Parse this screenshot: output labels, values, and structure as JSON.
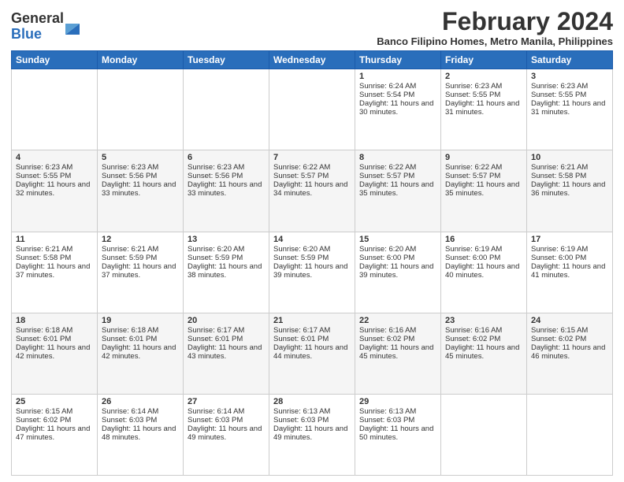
{
  "logo": {
    "line1": "General",
    "line2": "Blue",
    "icon_color": "#2a6ebb"
  },
  "header": {
    "month_year": "February 2024",
    "location": "Banco Filipino Homes, Metro Manila, Philippines"
  },
  "weekdays": [
    "Sunday",
    "Monday",
    "Tuesday",
    "Wednesday",
    "Thursday",
    "Friday",
    "Saturday"
  ],
  "weeks": [
    [
      {
        "day": "",
        "sun": "",
        "info": ""
      },
      {
        "day": "",
        "info": ""
      },
      {
        "day": "",
        "info": ""
      },
      {
        "day": "",
        "info": ""
      },
      {
        "day": "1",
        "info": "Sunrise: 6:24 AM\nSunset: 5:54 PM\nDaylight: 11 hours and 30 minutes."
      },
      {
        "day": "2",
        "info": "Sunrise: 6:23 AM\nSunset: 5:55 PM\nDaylight: 11 hours and 31 minutes."
      },
      {
        "day": "3",
        "info": "Sunrise: 6:23 AM\nSunset: 5:55 PM\nDaylight: 11 hours and 31 minutes."
      }
    ],
    [
      {
        "day": "4",
        "info": "Sunrise: 6:23 AM\nSunset: 5:55 PM\nDaylight: 11 hours and 32 minutes."
      },
      {
        "day": "5",
        "info": "Sunrise: 6:23 AM\nSunset: 5:56 PM\nDaylight: 11 hours and 33 minutes."
      },
      {
        "day": "6",
        "info": "Sunrise: 6:23 AM\nSunset: 5:56 PM\nDaylight: 11 hours and 33 minutes."
      },
      {
        "day": "7",
        "info": "Sunrise: 6:22 AM\nSunset: 5:57 PM\nDaylight: 11 hours and 34 minutes."
      },
      {
        "day": "8",
        "info": "Sunrise: 6:22 AM\nSunset: 5:57 PM\nDaylight: 11 hours and 35 minutes."
      },
      {
        "day": "9",
        "info": "Sunrise: 6:22 AM\nSunset: 5:57 PM\nDaylight: 11 hours and 35 minutes."
      },
      {
        "day": "10",
        "info": "Sunrise: 6:21 AM\nSunset: 5:58 PM\nDaylight: 11 hours and 36 minutes."
      }
    ],
    [
      {
        "day": "11",
        "info": "Sunrise: 6:21 AM\nSunset: 5:58 PM\nDaylight: 11 hours and 37 minutes."
      },
      {
        "day": "12",
        "info": "Sunrise: 6:21 AM\nSunset: 5:59 PM\nDaylight: 11 hours and 37 minutes."
      },
      {
        "day": "13",
        "info": "Sunrise: 6:20 AM\nSunset: 5:59 PM\nDaylight: 11 hours and 38 minutes."
      },
      {
        "day": "14",
        "info": "Sunrise: 6:20 AM\nSunset: 5:59 PM\nDaylight: 11 hours and 39 minutes."
      },
      {
        "day": "15",
        "info": "Sunrise: 6:20 AM\nSunset: 6:00 PM\nDaylight: 11 hours and 39 minutes."
      },
      {
        "day": "16",
        "info": "Sunrise: 6:19 AM\nSunset: 6:00 PM\nDaylight: 11 hours and 40 minutes."
      },
      {
        "day": "17",
        "info": "Sunrise: 6:19 AM\nSunset: 6:00 PM\nDaylight: 11 hours and 41 minutes."
      }
    ],
    [
      {
        "day": "18",
        "info": "Sunrise: 6:18 AM\nSunset: 6:01 PM\nDaylight: 11 hours and 42 minutes."
      },
      {
        "day": "19",
        "info": "Sunrise: 6:18 AM\nSunset: 6:01 PM\nDaylight: 11 hours and 42 minutes."
      },
      {
        "day": "20",
        "info": "Sunrise: 6:17 AM\nSunset: 6:01 PM\nDaylight: 11 hours and 43 minutes."
      },
      {
        "day": "21",
        "info": "Sunrise: 6:17 AM\nSunset: 6:01 PM\nDaylight: 11 hours and 44 minutes."
      },
      {
        "day": "22",
        "info": "Sunrise: 6:16 AM\nSunset: 6:02 PM\nDaylight: 11 hours and 45 minutes."
      },
      {
        "day": "23",
        "info": "Sunrise: 6:16 AM\nSunset: 6:02 PM\nDaylight: 11 hours and 45 minutes."
      },
      {
        "day": "24",
        "info": "Sunrise: 6:15 AM\nSunset: 6:02 PM\nDaylight: 11 hours and 46 minutes."
      }
    ],
    [
      {
        "day": "25",
        "info": "Sunrise: 6:15 AM\nSunset: 6:02 PM\nDaylight: 11 hours and 47 minutes."
      },
      {
        "day": "26",
        "info": "Sunrise: 6:14 AM\nSunset: 6:03 PM\nDaylight: 11 hours and 48 minutes."
      },
      {
        "day": "27",
        "info": "Sunrise: 6:14 AM\nSunset: 6:03 PM\nDaylight: 11 hours and 49 minutes."
      },
      {
        "day": "28",
        "info": "Sunrise: 6:13 AM\nSunset: 6:03 PM\nDaylight: 11 hours and 49 minutes."
      },
      {
        "day": "29",
        "info": "Sunrise: 6:13 AM\nSunset: 6:03 PM\nDaylight: 11 hours and 50 minutes."
      },
      {
        "day": "",
        "info": ""
      },
      {
        "day": "",
        "info": ""
      }
    ]
  ]
}
